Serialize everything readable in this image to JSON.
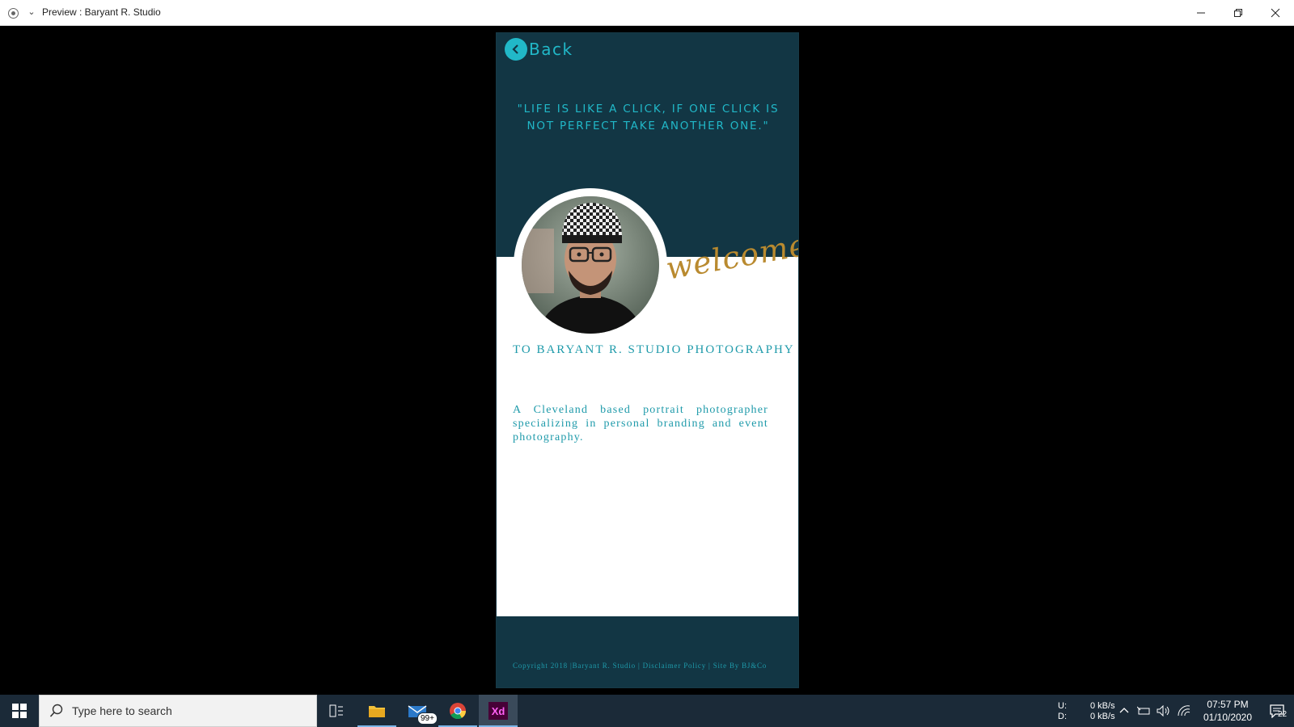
{
  "window": {
    "title": "Preview : Baryant R. Studio"
  },
  "page": {
    "back_label": "Back",
    "quote": "\"LIFE IS LIKE A CLICK, IF ONE CLICK IS NOT PERFECT TAKE ANOTHER ONE.\"",
    "welcome": "welcome",
    "studio_title": "TO BARYANT R. STUDIO PHOTOGRAPHY",
    "description": "A Cleveland based portrait photographer specializing in personal branding and event photography.",
    "footer_text": "Copyright 2018  |Baryant R. Studio |  Disclaimer Policy | Site By BJ&Co",
    "colors": {
      "dark": "#123644",
      "accent": "#21b8c8",
      "gold": "#b98a2f"
    }
  },
  "taskbar": {
    "search_placeholder": "Type here to search",
    "mail_badge": "99+",
    "xd_label": "Xd",
    "net_up_label": "U:",
    "net_down_label": "D:",
    "net_up_value": "0 kB/s",
    "net_down_value": "0 kB/s",
    "time": "07:57 PM",
    "date": "01/10/2020",
    "notification_count": "22"
  }
}
